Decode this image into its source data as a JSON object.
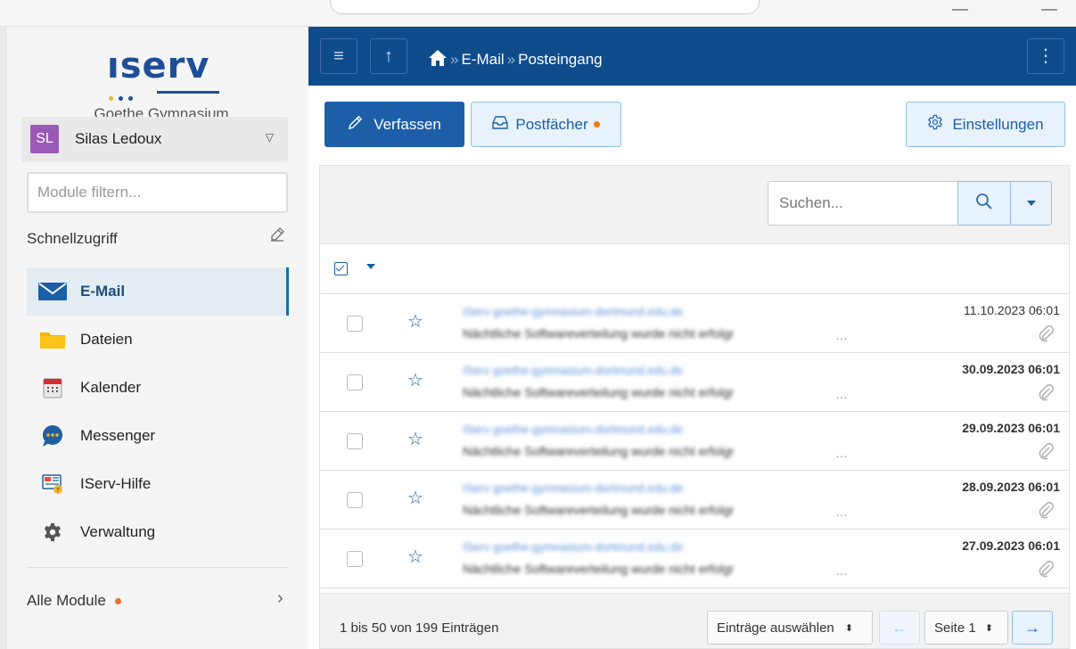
{
  "sidebar": {
    "logo_text": "ıserv",
    "school_name": "Goethe Gymnasium",
    "user": {
      "initials": "SL",
      "name": "Silas Ledoux"
    },
    "module_filter_placeholder": "Module filtern...",
    "quick_access_label": "Schnellzugriff",
    "items": [
      {
        "label": "E-Mail",
        "icon": "mail-icon",
        "active": true
      },
      {
        "label": "Dateien",
        "icon": "folder-icon",
        "active": false
      },
      {
        "label": "Kalender",
        "icon": "calendar-icon",
        "active": false
      },
      {
        "label": "Messenger",
        "icon": "chat-icon",
        "active": false
      },
      {
        "label": "IServ-Hilfe",
        "icon": "help-icon",
        "active": false
      },
      {
        "label": "Verwaltung",
        "icon": "gear-icon",
        "active": false
      }
    ],
    "all_modules_label": "Alle Module"
  },
  "topbar": {
    "breadcrumb": [
      "E-Mail",
      "Posteingang"
    ]
  },
  "toolbar": {
    "compose_label": "Verfassen",
    "mailboxes_label": "Postfächer",
    "settings_label": "Einstellungen"
  },
  "search": {
    "placeholder": "Suchen..."
  },
  "messages": [
    {
      "sender": "IServ goethe-gymnasium-dortmund.edu.de",
      "subject": "Nächtliche Softwareverteilung wurde nicht erfolgr",
      "date": "11.10.2023 06:01",
      "unread": false
    },
    {
      "sender": "IServ goethe-gymnasium-dortmund.edu.de",
      "subject": "Nächtliche Softwareverteilung wurde nicht erfolgr",
      "date": "30.09.2023 06:01",
      "unread": true
    },
    {
      "sender": "IServ goethe-gymnasium-dortmund.edu.de",
      "subject": "Nächtliche Softwareverteilung wurde nicht erfolgr",
      "date": "29.09.2023 06:01",
      "unread": true
    },
    {
      "sender": "IServ goethe-gymnasium-dortmund.edu.de",
      "subject": "Nächtliche Softwareverteilung wurde nicht erfolgr",
      "date": "28.09.2023 06:01",
      "unread": true
    },
    {
      "sender": "IServ goethe-gymnasium-dortmund.edu.de",
      "subject": "Nächtliche Softwareverteilung wurde nicht erfolgr",
      "date": "27.09.2023 06:01",
      "unread": true
    }
  ],
  "footer": {
    "count_text": "1 bis 50 von 199 Einträgen",
    "select_label": "Einträge auswählen",
    "page_label": "Seite 1"
  },
  "colors": {
    "brand": "#0f4c8c",
    "primary_button": "#1c5fa8",
    "accent_dot": "#f57c00",
    "avatar": "#9b59b6"
  }
}
